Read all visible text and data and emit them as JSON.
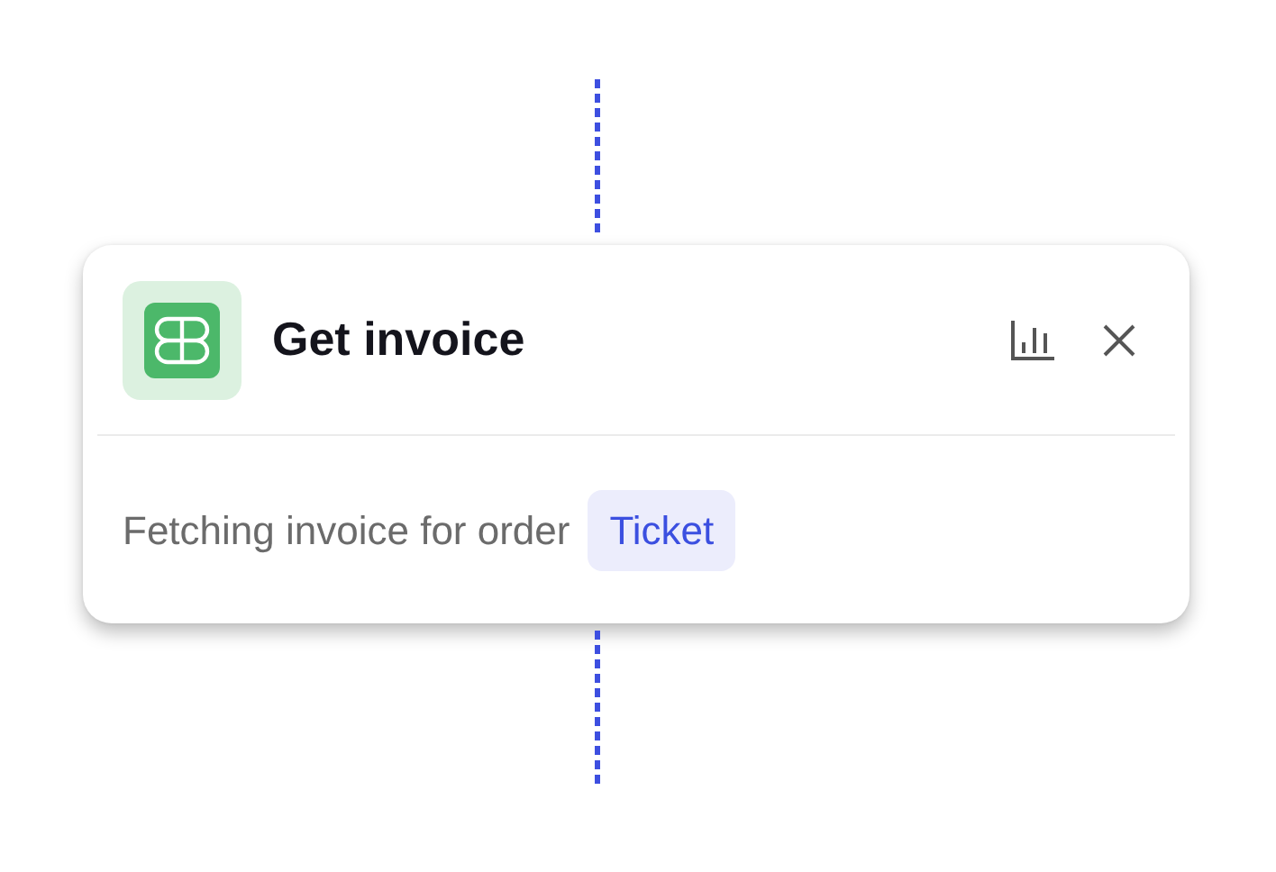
{
  "step": {
    "title": "Get invoice",
    "description": "Fetching invoice for order",
    "tag": "Ticket"
  }
}
